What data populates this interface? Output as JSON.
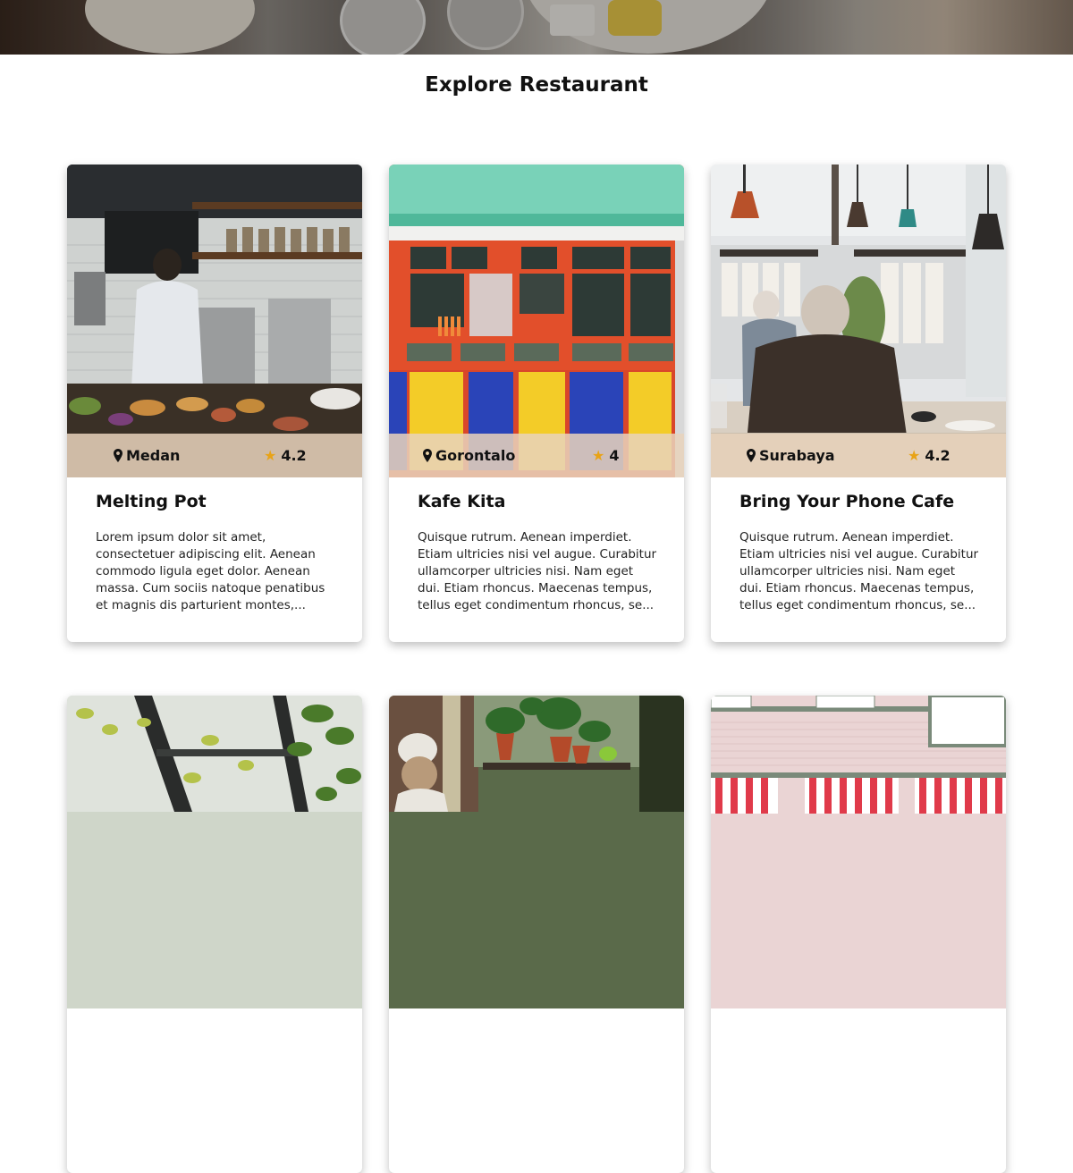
{
  "page": {
    "title": "Explore Restaurant"
  },
  "restaurants": [
    {
      "name": "Melting Pot",
      "city": "Medan",
      "rating": "4.2",
      "description": "Lorem ipsum dolor sit amet, consectetuer adipiscing elit. Aenean commodo ligula eget dolor. Aenean massa. Cum sociis natoque penatibus et magnis dis parturient montes,..."
    },
    {
      "name": "Kafe Kita",
      "city": "Gorontalo",
      "rating": "4",
      "description": "Quisque rutrum. Aenean imperdiet. Etiam ultricies nisi vel augue. Curabitur ullamcorper ultricies nisi. Nam eget dui. Etiam rhoncus. Maecenas tempus, tellus eget condimentum rhoncus, se..."
    },
    {
      "name": "Bring Your Phone Cafe",
      "city": "Surabaya",
      "rating": "4.2",
      "description": "Quisque rutrum. Aenean imperdiet. Etiam ultricies nisi vel augue. Curabitur ullamcorper ultricies nisi. Nam eget dui. Etiam rhoncus. Maecenas tempus, tellus eget condimentum rhoncus, se..."
    }
  ],
  "icons": {
    "location": "map-pin-icon",
    "rating": "star-icon"
  },
  "colors": {
    "star": "#e8a317",
    "meta_bar": "#e8d3bc"
  }
}
